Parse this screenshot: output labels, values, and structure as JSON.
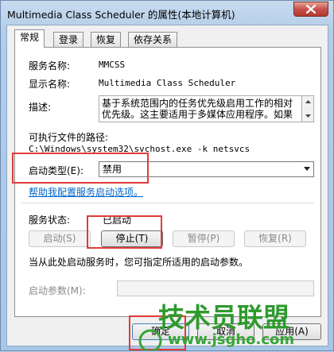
{
  "window": {
    "title": "Multimedia Class Scheduler 的属性(本地计算机)"
  },
  "tabs": [
    {
      "label": "常规"
    },
    {
      "label": "登录"
    },
    {
      "label": "恢复"
    },
    {
      "label": "依存关系"
    }
  ],
  "general": {
    "service_name_label": "服务名称:",
    "service_name_value": "MMCSS",
    "display_name_label": "显示名称:",
    "display_name_value": "Multimedia Class Scheduler",
    "description_label": "描述:",
    "description_value": "基于系统范围内的任务优先级启用工作的相对优先级。这主要适用于多媒体应用程序。如果",
    "exe_path_label": "可执行文件的路径:",
    "exe_path_value": "C:\\Windows\\system32\\svchost.exe -k netsvcs",
    "startup_type_label": "启动类型(E):",
    "startup_type_value": "禁用",
    "help_link": "帮助我配置服务启动选项。",
    "status_label": "服务状态:",
    "status_value": "已启动",
    "start_button": "启动(S)",
    "stop_button": "停止(T)",
    "pause_button": "暂停(P)",
    "resume_button": "恢复(R)",
    "hint_text": "当从此处启动服务时，您可指定所适用的启动参数。",
    "start_params_label": "启动参数(M):"
  },
  "footer": {
    "ok_button": "确定",
    "cancel_button": "取消",
    "apply_button": "应用(A)"
  },
  "watermark": {
    "logo_text": "技术员联盟",
    "url": "www.jsgho.com"
  },
  "colors": {
    "highlight": "#e23a3a",
    "link": "#0066cc",
    "watermark": "#2e9a2e"
  }
}
